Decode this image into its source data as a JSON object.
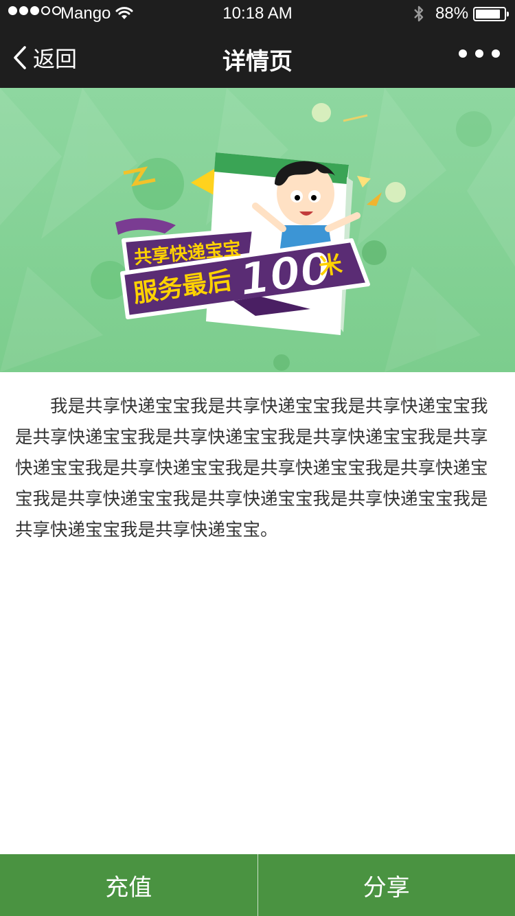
{
  "status_bar": {
    "carrier": "Mango",
    "time": "10:18 AM",
    "battery_percent": "88%",
    "battery_level": 0.88,
    "signal_bars": 3,
    "signal_total": 5
  },
  "nav": {
    "back_label": "返回",
    "title": "详情页",
    "more_icon": "ellipsis-icon"
  },
  "banner": {
    "line1": "共享快递宝宝",
    "line2": "服务最后",
    "number": "100",
    "unit": "米",
    "background_color": "#86d496",
    "badge_color": "#5a2c74",
    "text_color": "#ffd200"
  },
  "article": {
    "text": "我是共享快递宝宝我是共享快递宝宝我是共享快递宝宝我是共享快递宝宝我是共享快递宝宝我是共享快递宝宝我是共享快递宝宝我是共享快递宝宝我是共享快递宝宝我是共享快递宝宝我是共享快递宝宝我是共享快递宝宝我是共享快递宝宝我是共享快递宝宝我是共享快递宝宝。"
  },
  "bottom_bar": {
    "recharge_label": "充值",
    "share_label": "分享",
    "button_color": "#4a9341"
  }
}
